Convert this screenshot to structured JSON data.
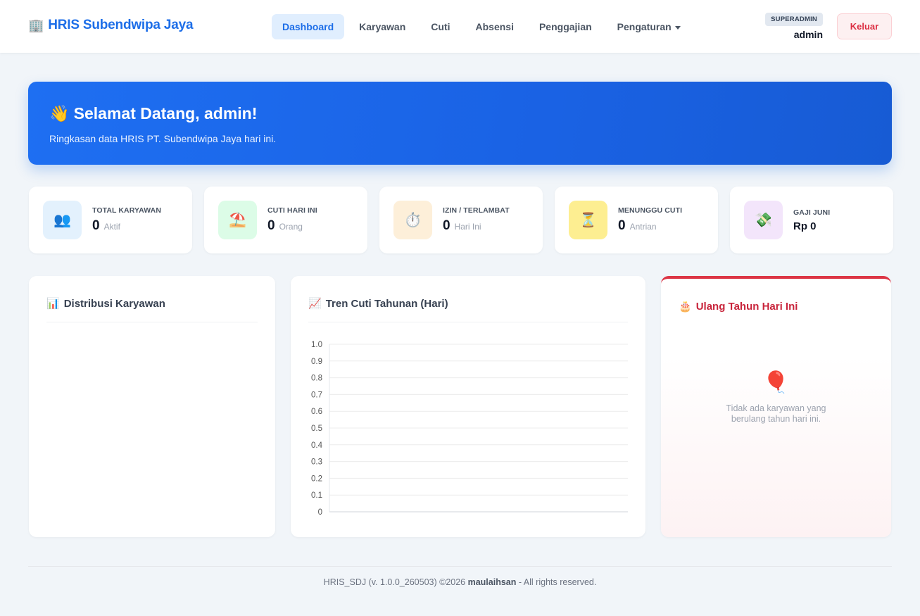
{
  "brand": {
    "icon": "🏢",
    "name": "HRIS Subendwipa Jaya"
  },
  "nav": [
    {
      "label": "Dashboard",
      "active": true
    },
    {
      "label": "Karyawan"
    },
    {
      "label": "Cuti"
    },
    {
      "label": "Absensi"
    },
    {
      "label": "Penggajian"
    },
    {
      "label": "Pengaturan",
      "dropdown": true
    }
  ],
  "user": {
    "role": "SUPERADMIN",
    "name": "admin",
    "logout_label": "Keluar"
  },
  "hero": {
    "emoji": "👋",
    "title": "Selamat Datang, admin!",
    "subtitle": "Ringkasan data HRIS PT. Subendwipa Jaya hari ini."
  },
  "stats": [
    {
      "icon": "👥",
      "icon_name": "people-icon",
      "bg": "#e3f1fd",
      "label": "TOTAL KARYAWAN",
      "value": "0",
      "unit": "Aktif"
    },
    {
      "icon": "⛱️",
      "icon_name": "beach-umbrella-icon",
      "bg": "#dcfce7",
      "label": "CUTI HARI INI",
      "value": "0",
      "unit": "Orang"
    },
    {
      "icon": "⏱️",
      "icon_name": "stopwatch-icon",
      "bg": "#fdefd9",
      "label": "IZIN / TERLAMBAT",
      "value": "0",
      "unit": "Hari Ini"
    },
    {
      "icon": "⏳",
      "icon_name": "hourglass-icon",
      "bg": "#fdee91",
      "label": "MENUNGGU CUTI",
      "value": "0",
      "unit": "Antrian"
    },
    {
      "icon": "💸",
      "icon_name": "money-icon",
      "bg": "#f3e5fb",
      "label": "GAJI JUNI",
      "value": "Rp 0",
      "unit": ""
    }
  ],
  "panels": {
    "distribusi": {
      "icon": "📊",
      "title": "Distribusi Karyawan"
    },
    "tren": {
      "icon": "📈",
      "title": "Tren Cuti Tahunan (Hari)"
    },
    "ulang_tahun": {
      "icon": "🎂",
      "title": "Ulang Tahun Hari Ini",
      "empty_icon": "🎈",
      "empty_text": "Tidak ada karyawan yang berulang tahun hari ini."
    }
  },
  "chart_data": {
    "type": "line",
    "title": "Tren Cuti Tahunan (Hari)",
    "series": [],
    "ylim": [
      0,
      1.0
    ],
    "yticks": [
      "0",
      "0.1",
      "0.2",
      "0.3",
      "0.4",
      "0.5",
      "0.6",
      "0.7",
      "0.8",
      "0.9",
      "1.0"
    ],
    "grid": true
  },
  "footer": {
    "prefix": "HRIS_SDJ (v. 1.0.0_260503) ©2026 ",
    "author": "maulaihsan",
    "suffix": " - All rights reserved."
  },
  "colors": {
    "primary": "#1d6ee8",
    "danger": "#dc3545",
    "background": "#f1f5f9"
  }
}
